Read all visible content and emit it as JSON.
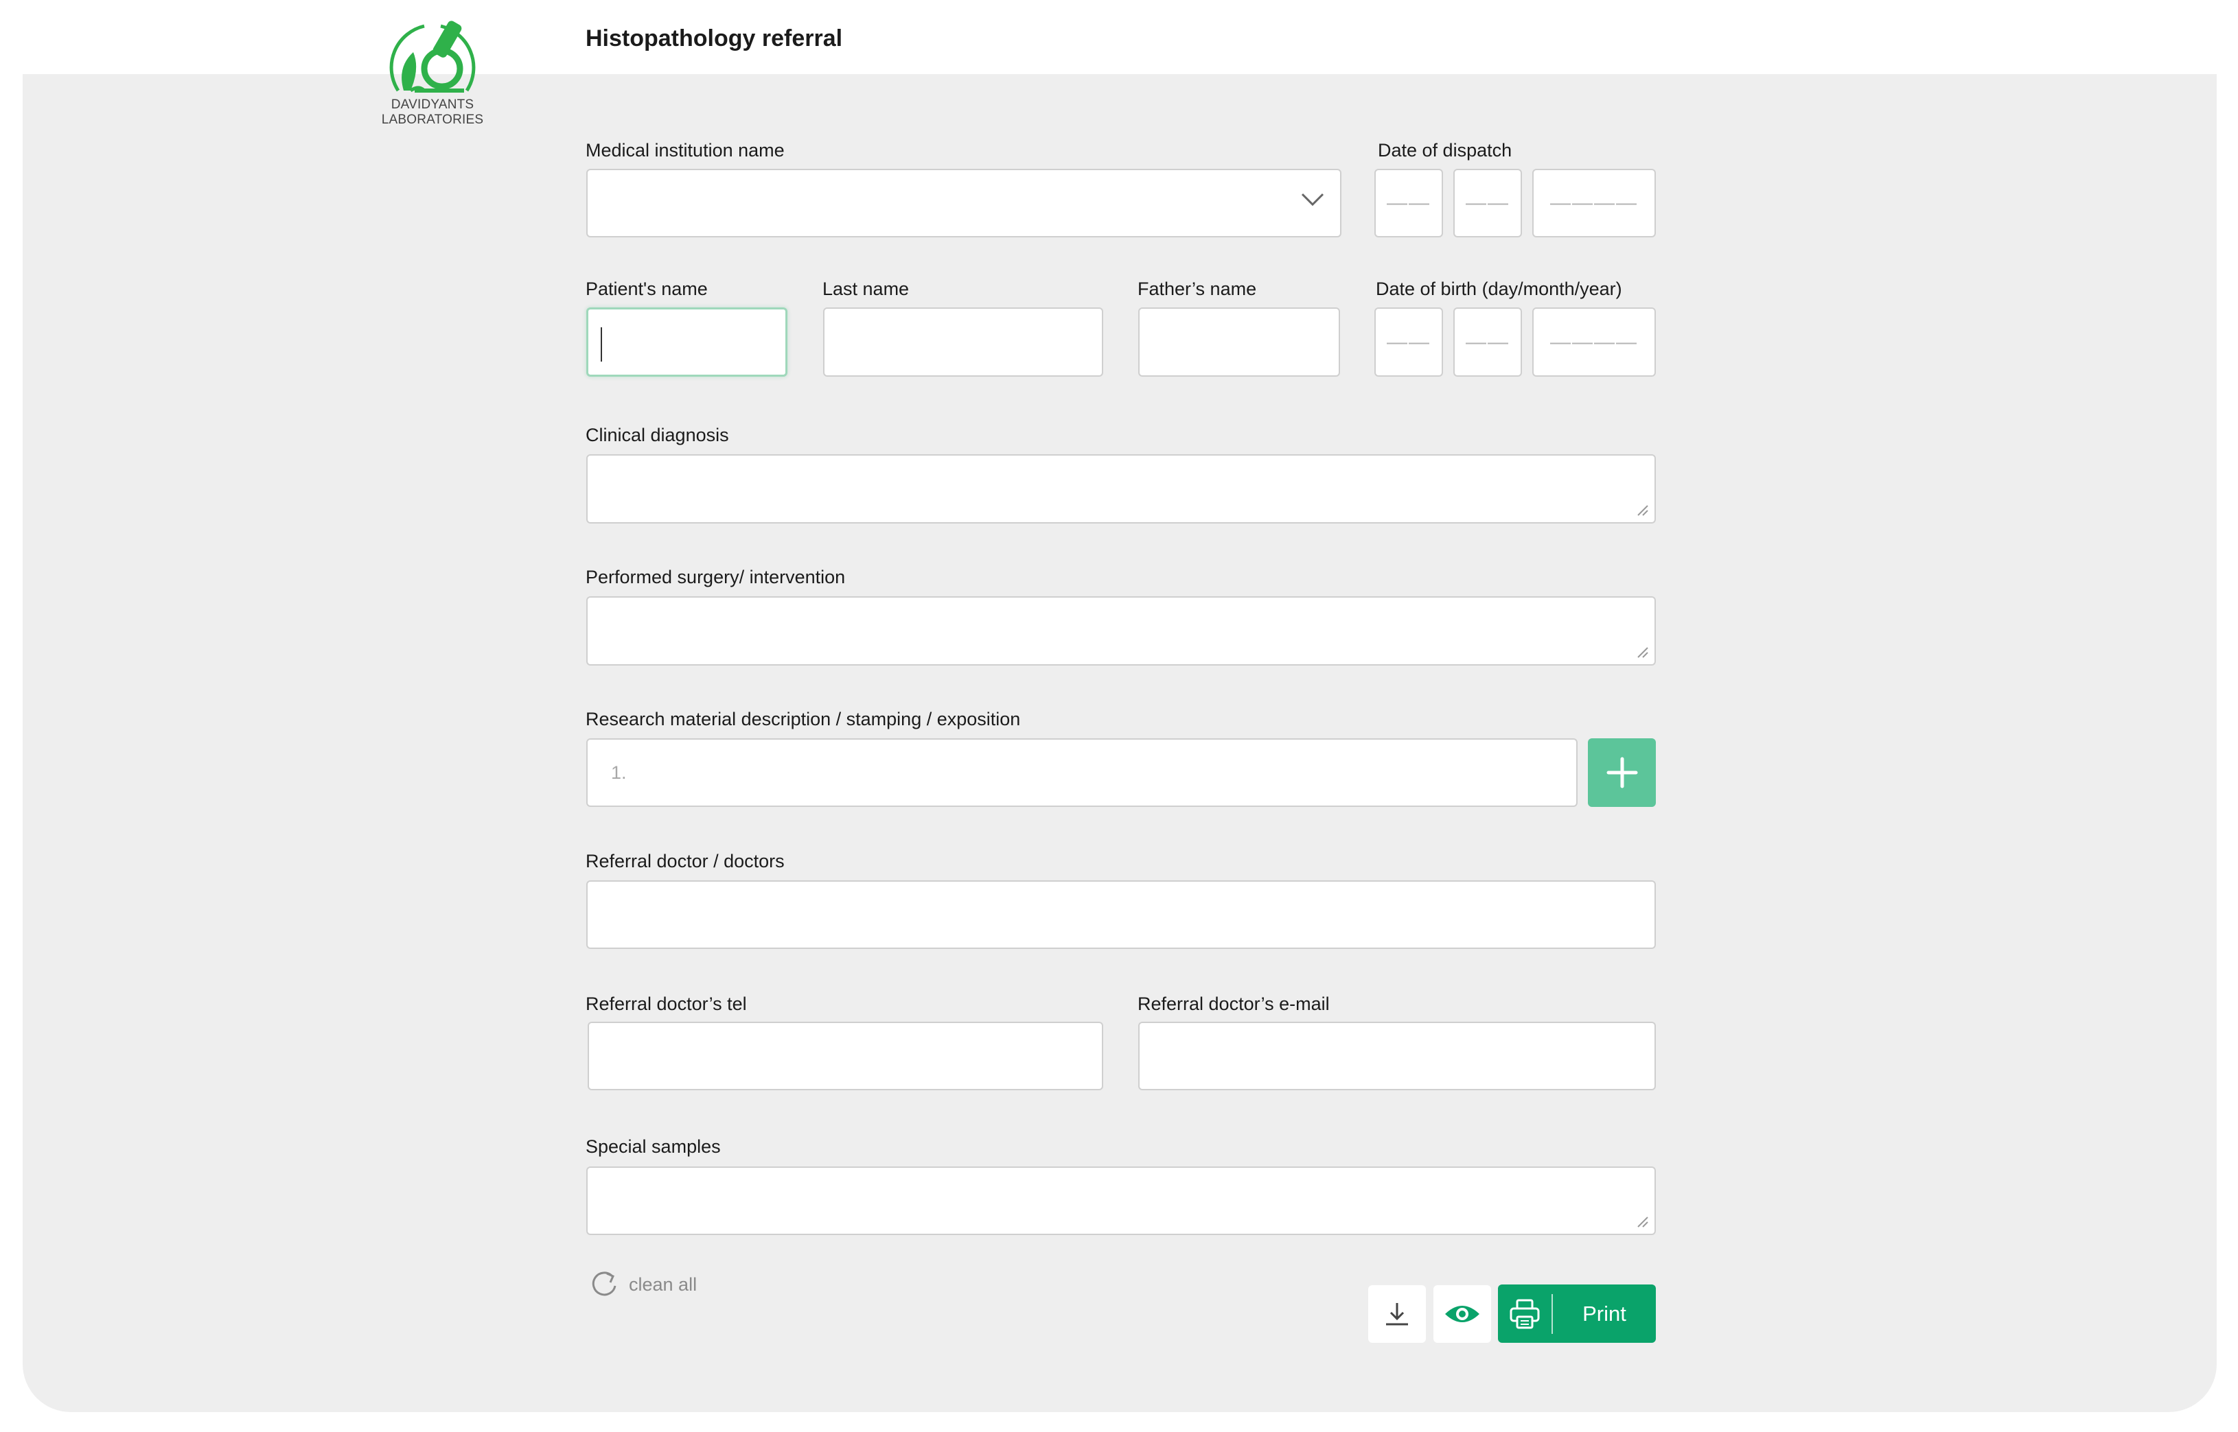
{
  "brand": {
    "name": "DAVIDYANTS LABORATORIES",
    "logo_icon": "microscope-leaf-icon",
    "accent": "#0aa36a",
    "accent_light": "#5cc59a"
  },
  "header": {
    "title": "Histopathology referral"
  },
  "form": {
    "institution": {
      "label": "Medical institution name",
      "value": ""
    },
    "dispatch_date": {
      "label": "Date of dispatch",
      "day": "——",
      "month": "——",
      "year": "————"
    },
    "patient_name": {
      "label": "Patient's name",
      "value": ""
    },
    "last_name": {
      "label": "Last name",
      "value": ""
    },
    "father_name": {
      "label": "Father’s name",
      "value": ""
    },
    "birth_date": {
      "label": "Date of birth (day/month/year)",
      "day": "——",
      "month": "——",
      "year": "————"
    },
    "clinical_diagnosis": {
      "label": "Clinical diagnosis",
      "value": ""
    },
    "surgery": {
      "label": "Performed surgery/ intervention",
      "value": ""
    },
    "research_material": {
      "label": "Research material description / stamping / exposition",
      "placeholder": "1."
    },
    "referral_doctors": {
      "label": "Referral doctor / doctors",
      "value": ""
    },
    "doctor_tel": {
      "label": "Referral doctor’s tel",
      "value": ""
    },
    "doctor_email": {
      "label": "Referral doctor’s e-mail",
      "value": ""
    },
    "special_samples": {
      "label": "Special samples",
      "value": ""
    }
  },
  "actions": {
    "clean_all": "clean all",
    "print": "Print"
  }
}
